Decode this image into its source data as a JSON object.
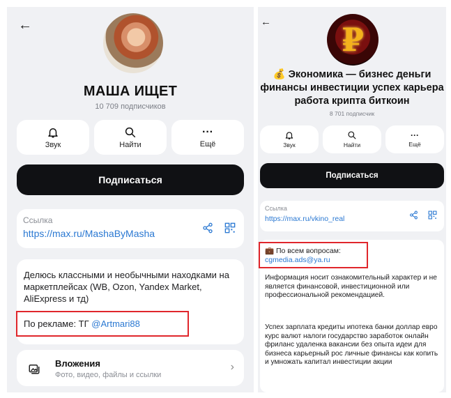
{
  "left": {
    "back_icon": "arrow-left-icon",
    "channel_title": "МАША ИЩЕТ",
    "subscribers": "10 709 подписчиков",
    "actions": [
      {
        "label": "Звук",
        "icon": "bell-icon"
      },
      {
        "label": "Найти",
        "icon": "search-icon"
      },
      {
        "label": "Ещё",
        "icon": "more-icon"
      }
    ],
    "subscribe_label": "Подписаться",
    "link_caption": "Ссылка",
    "link_url": "https://max.ru/MashaByMasha",
    "description": "Делюсь классными и необычными находками на маркетплейсах (WB, Ozon, Yandex Market, AliExpress и тд)",
    "ad_prefix": "По рекламе: ТГ ",
    "ad_handle": "@Artmari88",
    "attachments_title": "Вложения",
    "attachments_subtitle": "Фото, видео, файлы и ссылки"
  },
  "right": {
    "back_icon": "arrow-left-icon",
    "channel_title": "💰 Экономика — бизнес деньги финансы инвестиции успех карьера работа крипта биткоин",
    "subscribers": "8 701 подписчик",
    "actions": [
      {
        "label": "Звук",
        "icon": "bell-icon"
      },
      {
        "label": "Найти",
        "icon": "search-icon"
      },
      {
        "label": "Ещё",
        "icon": "more-icon"
      }
    ],
    "subscribe_label": "Подписаться",
    "link_caption": "Ссылка",
    "link_url": "https://max.ru/vkino_real",
    "contact_label": "💼 По всем вопросам:",
    "contact_email": "cgmedia.ads@ya.ru",
    "disclaimer": "Информация носит ознакомительный характер и не является финансовой, инвестиционной или профессиональной рекомендацией.",
    "keywords": "Успех зарплата кредиты ипотека банки доллар евро курс валют налоги государство заработок онлайн фриланс удаленка вакансии без опыта идеи для бизнеса карьерный рос личные финансы как копить и умножать капитал инвестиции акции"
  },
  "colors": {
    "accent": "#2a78d2",
    "highlight": "#e0262b",
    "background": "#f0f1f4",
    "button": "#101114"
  }
}
